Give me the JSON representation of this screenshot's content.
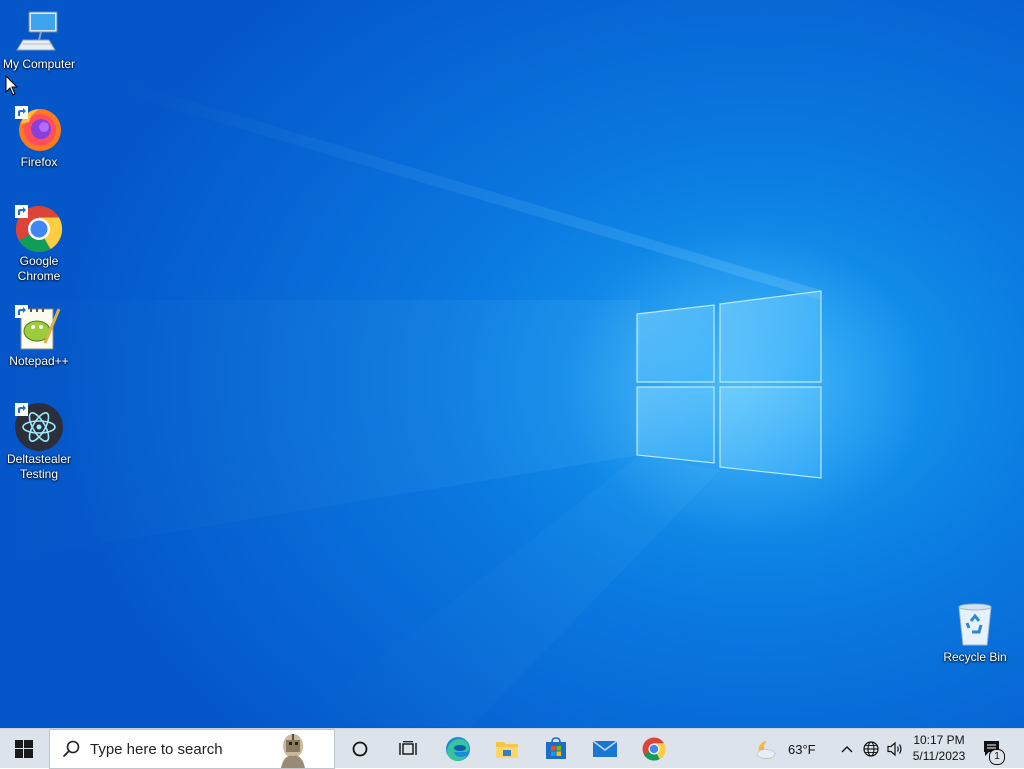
{
  "desktop": {
    "icons": [
      {
        "label": "My Computer",
        "icon": "computer-icon"
      },
      {
        "label": "Firefox",
        "icon": "firefox-icon"
      },
      {
        "label": "Google Chrome",
        "icon": "chrome-icon"
      },
      {
        "label": "Notepad++",
        "icon": "notepad-plus-plus-icon"
      },
      {
        "label": "Deltastealer Testing",
        "icon": "electron-app-icon"
      },
      {
        "label": "Recycle Bin",
        "icon": "recycle-bin-icon"
      }
    ]
  },
  "taskbar": {
    "search": {
      "placeholder": "Type here to search"
    },
    "pinned": [
      {
        "icon": "cortana-icon"
      },
      {
        "icon": "task-view-icon"
      },
      {
        "icon": "edge-icon"
      },
      {
        "icon": "file-explorer-icon"
      },
      {
        "icon": "microsoft-store-icon"
      },
      {
        "icon": "mail-icon"
      },
      {
        "icon": "chrome-icon"
      }
    ],
    "weather": {
      "temp": "63°F",
      "icon": "weather-partly-cloudy-icon"
    },
    "tray": {
      "icons": [
        "chevron-up-icon",
        "network-globe-icon",
        "volume-icon"
      ]
    },
    "clock": {
      "time": "10:17 PM",
      "date": "5/11/2023"
    },
    "notifications": {
      "count": "1"
    }
  },
  "colors": {
    "wallpaper_blue": "#0a79e0",
    "taskbar_bg": "#dde3ea",
    "search_bg": "#ffffff"
  }
}
